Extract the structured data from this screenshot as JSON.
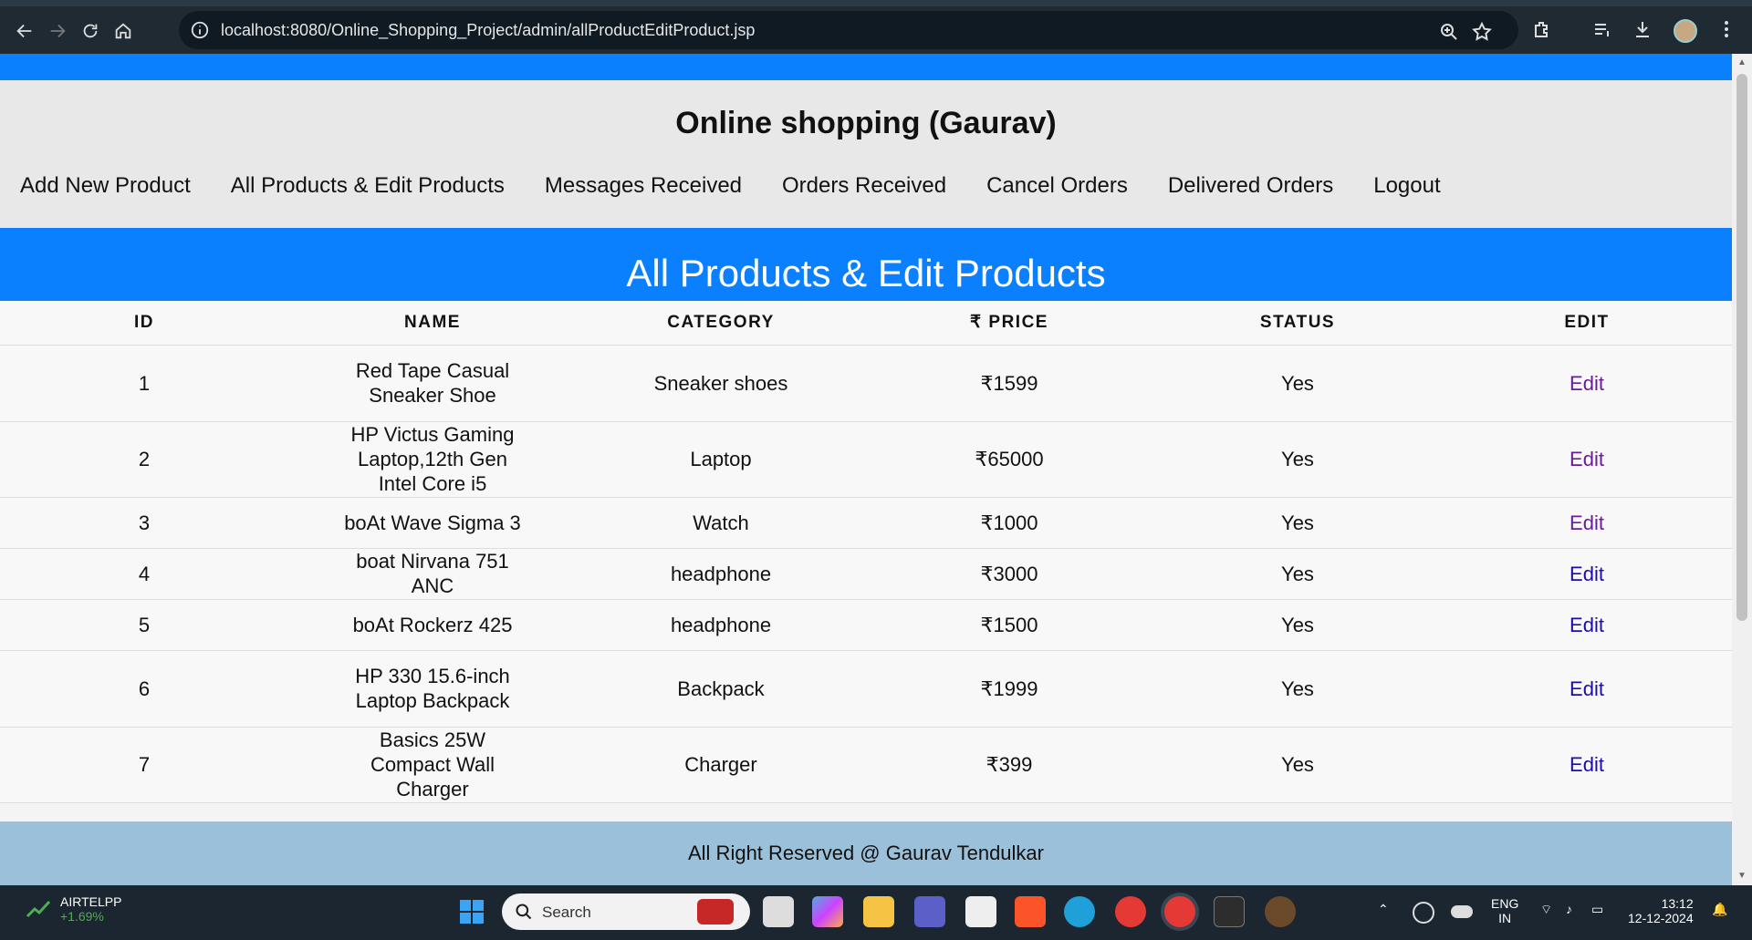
{
  "browser": {
    "url": "localhost:8080/Online_Shopping_Project/admin/allProductEditProduct.jsp"
  },
  "header": {
    "title": "Online shopping (Gaurav)",
    "nav": [
      "Add New Product",
      "All Products & Edit Products",
      "Messages Received",
      "Orders Received",
      "Cancel Orders",
      "Delivered Orders",
      "Logout"
    ]
  },
  "main": {
    "heading": "All Products & Edit Products",
    "columns": [
      "ID",
      "NAME",
      "CATEGORY",
      "₹ PRICE",
      "STATUS",
      "EDIT"
    ],
    "rows": [
      {
        "id": "1",
        "name": "Red Tape Casual Sneaker Shoe",
        "category": "Sneaker shoes",
        "price": "₹1599",
        "status": "Yes",
        "edit": "Edit"
      },
      {
        "id": "2",
        "name": "HP Victus Gaming Laptop,12th Gen Intel Core i5",
        "category": "Laptop",
        "price": "₹65000",
        "status": "Yes",
        "edit": "Edit"
      },
      {
        "id": "3",
        "name": "boAt Wave Sigma 3",
        "category": "Watch",
        "price": "₹1000",
        "status": "Yes",
        "edit": "Edit"
      },
      {
        "id": "4",
        "name": "boat Nirvana 751 ANC",
        "category": "headphone",
        "price": "₹3000",
        "status": "Yes",
        "edit": "Edit"
      },
      {
        "id": "5",
        "name": "boAt Rockerz 425",
        "category": "headphone",
        "price": "₹1500",
        "status": "Yes",
        "edit": "Edit"
      },
      {
        "id": "6",
        "name": "HP 330 15.6-inch Laptop Backpack",
        "category": "Backpack",
        "price": "₹1999",
        "status": "Yes",
        "edit": "Edit"
      },
      {
        "id": "7",
        "name": "Basics 25W Compact Wall Charger",
        "category": "Charger",
        "price": "₹399",
        "status": "Yes",
        "edit": "Edit"
      }
    ]
  },
  "footer": {
    "text": "All Right Reserved @ Gaurav Tendulkar"
  },
  "taskbar": {
    "stock_name": "AIRTELPP",
    "stock_change": "+1.69%",
    "search_placeholder": "Search",
    "language": "ENG",
    "region": "IN",
    "time": "13:12",
    "date": "12-12-2024"
  },
  "colors": {
    "accent": "#0a80ff",
    "footer": "#9bc0d9",
    "link": "#1a0dab",
    "visited": "#6a1b9a"
  }
}
